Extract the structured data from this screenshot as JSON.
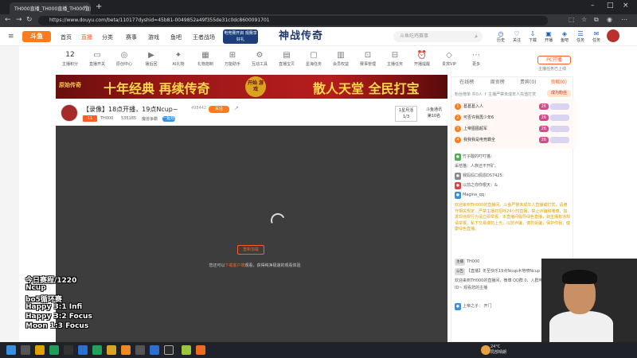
{
  "browser": {
    "tab_title": "TH000直播_TH000直播_TH000直播",
    "url": "https://www.douyu.com/beta/110177dyshid=45b81-0049852a49f355de31c0dc8600091701"
  },
  "site": {
    "logo": "斗鱼",
    "nav": [
      "首页",
      "直播",
      "分类",
      "赛事",
      "游戏",
      "鱼吧",
      "王者战场"
    ],
    "promo": "电竞赛开启 观赛享好礼",
    "hero_text": "神战传奇",
    "search_placeholder": "斗鱼吃鸡赛事",
    "header_icons": [
      "历史",
      "关注",
      "下载",
      "开播",
      "鱼吧",
      "任务",
      "任务"
    ]
  },
  "toolbar": {
    "count": "12",
    "items": [
      "主播积分",
      "直播开关",
      "原创中心",
      "播后回",
      "AI礼物",
      "礼物炮制",
      "万能助手",
      "互动工具",
      "直播宝贝",
      "星海任务",
      "会员权益",
      "赛事管理",
      "主播任务",
      "开播提醒",
      "贵宾VIP",
      "更多"
    ],
    "pc_button": "PC开播",
    "pc_sub": "主播任务已上线"
  },
  "banner": {
    "side": "原始传奇",
    "left": "十年经典 再续传奇",
    "seal": "开始 游戏",
    "right": "散人天堂 全民打宝"
  },
  "room": {
    "title": "【录像】18点开播，19点Ncup~",
    "follow_count": "498442",
    "follow_label": "关注",
    "level": "11",
    "streamer": "TH000",
    "room_id": "535185",
    "category": "魔兽争霸",
    "tag": "一起玩",
    "rank_label": "1星月活",
    "rank_value": "1/3",
    "rank2_label": "斗鱼通讯",
    "rank2_value": "第10名"
  },
  "player": {
    "retry": "重新加载",
    "hint_pre": "您还可以",
    "hint_link": "下载客户端",
    "hint_post": "观看，获得纯净极速的观看体验"
  },
  "right_panel": {
    "tabs": [
      "在线榜",
      "周贡榜",
      "贵宾(0)",
      "贡献(0)"
    ],
    "fan_line": "粉丝榜单  共0人    ↑ 主播严禁未成年人充值打赏",
    "fan_btn": "成为粉丝",
    "ranks": [
      {
        "n": "1",
        "name": "葛葛葛入人",
        "badge": "26"
      },
      {
        "n": "2",
        "name": "可否许我再少年6",
        "badge": "26"
      },
      {
        "n": "3",
        "name": "上帝图图超军",
        "badge": "26"
      },
      {
        "n": "4",
        "name": "我我我是电竞霸全",
        "badge": "26"
      }
    ],
    "chats": [
      "竹子酸的叮叮猫：",
      "采桔猫：人族还不开矿。",
      "我妈妈口佩恩DS7425：",
      "以前之你你根天：&",
      "Magina_qq："
    ],
    "notice": "欢迎来到TH000的直播间。斗鱼严禁未成年人直播或打赏，请遵守相关规定，严禁主播打招呼24小时直播，禁止诈骗和赌博，如发现违规行为请立即举报。本直播间倡导绿色直播，如主播有违规请举报，私下交易谨防上当，以防诈骗，谨防受骗，保护你我，健康绿色直播。",
    "owner_label": "主播",
    "owner_name": "TH000",
    "bulletin_label": "公告",
    "bulletin": "【直播】冬至快乐19点Ncup木地喷Ncup",
    "owner_msg": "欢迎来到TH000的直播间，微博 QQ群 0、入群申请请注明斗鱼ID~ 观看您的主播",
    "last_label": "上帝之子",
    "last_msg": "开门"
  },
  "overlay": [
    "今日赛程/1220",
    "Ncup",
    "bo5循环赛",
    "Happy 3:1 Infi",
    "Happy 3:2 Focus",
    "Moon 1:3 Focus"
  ],
  "taskbar": {
    "temp": "24°C",
    "weather": "局部晴朗"
  }
}
